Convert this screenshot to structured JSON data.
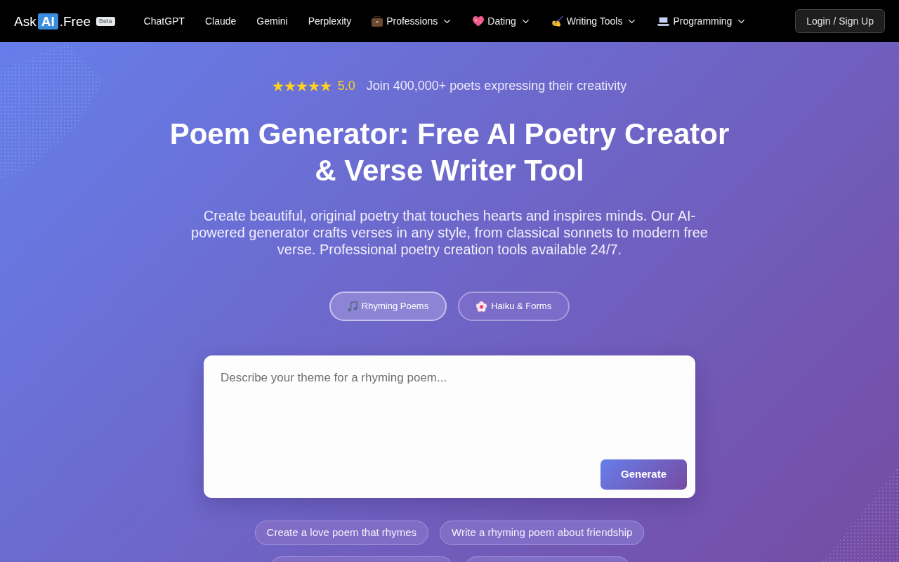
{
  "nav": {
    "logo": {
      "prefix": "Ask",
      "highlight": "AI",
      "suffix": ".Free",
      "badge": "Beta"
    },
    "links": [
      {
        "label": "ChatGPT",
        "kind": "link"
      },
      {
        "label": "Claude",
        "kind": "link"
      },
      {
        "label": "Gemini",
        "kind": "link"
      },
      {
        "label": "Perplexity",
        "kind": "link"
      },
      {
        "label": "Professions",
        "kind": "dropdown"
      },
      {
        "label": "Dating",
        "kind": "dropdown"
      },
      {
        "label": "Writing Tools",
        "kind": "dropdown"
      },
      {
        "label": "Programming",
        "kind": "dropdown"
      }
    ],
    "login": "Login / Sign Up"
  },
  "hero": {
    "rating": {
      "stars": 5,
      "score": "5.0"
    },
    "tagline": "Join 400,000+ poets expressing their creativity",
    "title": "Poem Generator: Free AI Poetry Creator & Verse Writer Tool",
    "subtitle": "Create beautiful, original poetry that touches hearts and inspires minds. Our AI-powered generator crafts verses in any style, from classical sonnets to modern free verse. Professional poetry creation tools available 24/7."
  },
  "modes": [
    {
      "label": "Rhyming Poems",
      "selected": true
    },
    {
      "label": "Haiku & Forms",
      "selected": false
    }
  ],
  "prompt": {
    "placeholder": "Describe your theme for a rhyming poem...",
    "button": "Generate"
  },
  "suggestions": [
    "Create a love poem that rhymes",
    "Write a rhyming poem about friendship"
  ]
}
